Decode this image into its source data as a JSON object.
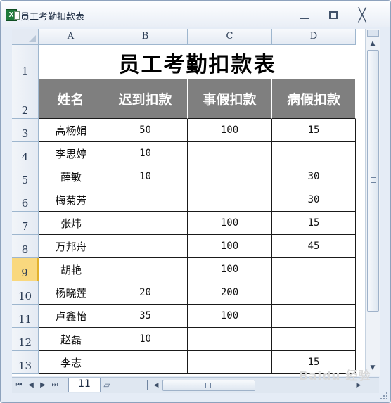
{
  "window": {
    "title": "员工考勤扣款表",
    "minimize_icon": "minimize-icon",
    "maximize_icon": "maximize-icon",
    "close_icon": "close-icon",
    "close_glyph": "╳"
  },
  "columns": [
    "A",
    "B",
    "C",
    "D"
  ],
  "rows": [
    "1",
    "2",
    "3",
    "4",
    "5",
    "6",
    "7",
    "8",
    "9",
    "10",
    "11",
    "12",
    "13"
  ],
  "selected_row": "9",
  "sheet": {
    "title": "员工考勤扣款表",
    "headers": [
      "姓名",
      "迟到扣款",
      "事假扣款",
      "病假扣款"
    ],
    "records": [
      [
        "高杨娟",
        "50",
        "100",
        "15"
      ],
      [
        "李思婷",
        "10",
        "",
        ""
      ],
      [
        "薛敏",
        "10",
        "",
        "30"
      ],
      [
        "梅菊芳",
        "",
        "",
        "30"
      ],
      [
        "张炜",
        "",
        "100",
        "15"
      ],
      [
        "万邦舟",
        "",
        "100",
        "45"
      ],
      [
        "胡艳",
        "",
        "100",
        ""
      ],
      [
        "杨晓莲",
        "20",
        "200",
        ""
      ],
      [
        "卢鑫怡",
        "35",
        "100",
        ""
      ],
      [
        "赵磊",
        "10",
        "",
        ""
      ],
      [
        "李志",
        "",
        "",
        "15"
      ]
    ]
  },
  "tabs": {
    "active": "11",
    "nav": [
      "⏮",
      "◀",
      "▶",
      "⏭"
    ]
  },
  "watermark": "Baidu 经验",
  "colors": {
    "header_fill": "#7f7f7f",
    "selected_row": "#f9d87e"
  }
}
